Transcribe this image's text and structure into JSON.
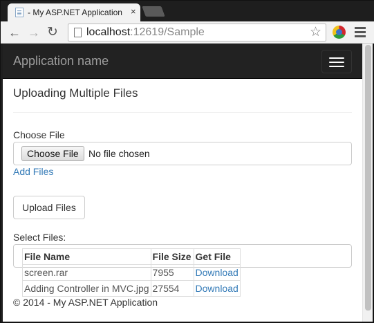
{
  "browser": {
    "tab_title": "- My ASP.NET Application",
    "tab_close": "×",
    "url_host": "localhost",
    "url_path": ":12619/Sample",
    "icons": {
      "back": "back-arrow-icon",
      "forward": "forward-arrow-icon",
      "reload": "reload-icon",
      "star": "bookmark-star-icon",
      "menu": "menu-icon"
    }
  },
  "navbar": {
    "brand": "Application name"
  },
  "page": {
    "title": "Uploading Multiple Files",
    "choose_label": "Choose File",
    "choose_button": "Choose File",
    "no_file_text": "No file chosen",
    "add_files_link": "Add Files",
    "upload_button": "Upload Files",
    "select_label": "Select Files:"
  },
  "files_table": {
    "headers": [
      "File Name",
      "File Size",
      "Get File"
    ],
    "rows": [
      {
        "name": "screen.rar",
        "size": "7955",
        "link": "Download"
      },
      {
        "name": "Adding Controller in MVC.jpg",
        "size": "27554",
        "link": "Download"
      }
    ]
  },
  "footer": {
    "text": "© 2014 - My ASP.NET Application"
  },
  "colors": {
    "navbar_bg": "#222222",
    "link": "#337ab7",
    "brand_text": "#9d9d9d"
  }
}
